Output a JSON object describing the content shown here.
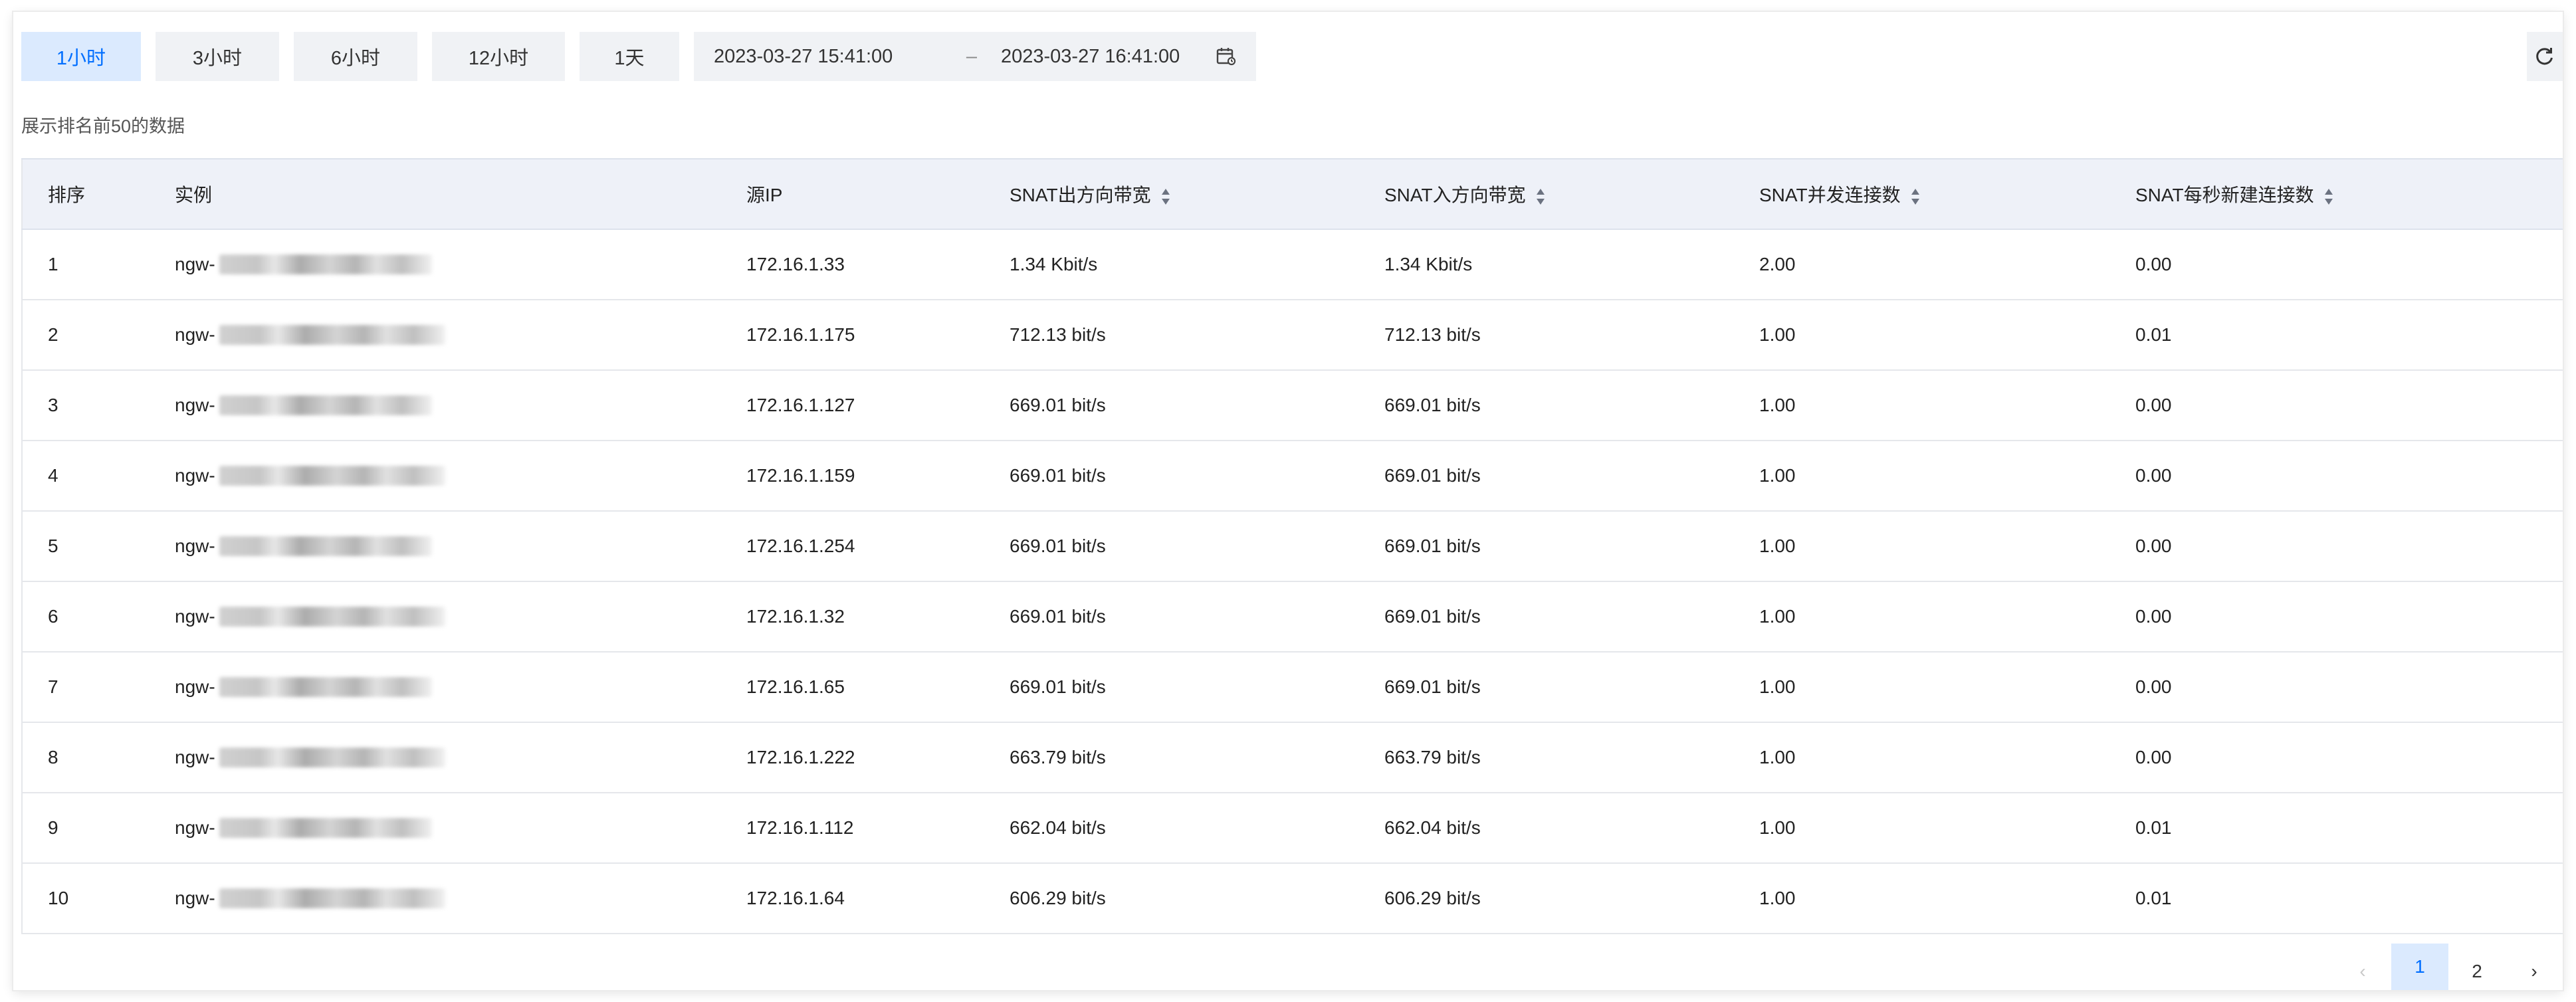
{
  "time_ranges": {
    "r1h": "1小时",
    "r3h": "3小时",
    "r6h": "6小时",
    "r12h": "12小时",
    "r1d": "1天"
  },
  "date_range": {
    "start": "2023-03-27 15:41:00",
    "separator": "–",
    "end": "2023-03-27 16:41:00"
  },
  "note": "展示排名前50的数据",
  "table": {
    "headers": {
      "rank": "排序",
      "instance": "实例",
      "source_ip": "源IP",
      "snat_out": "SNAT出方向带宽",
      "snat_in": "SNAT入方向带宽",
      "snat_conn": "SNAT并发连接数",
      "snat_new": "SNAT每秒新建连接数"
    },
    "rows": [
      {
        "rank": "1",
        "instance": "ngw-",
        "ip": "172.16.1.33",
        "out": "1.34 Kbit/s",
        "in": "1.34 Kbit/s",
        "conn": "2.00",
        "new": "0.00"
      },
      {
        "rank": "2",
        "instance": "ngw-",
        "ip": "172.16.1.175",
        "out": "712.13 bit/s",
        "in": "712.13 bit/s",
        "conn": "1.00",
        "new": "0.01"
      },
      {
        "rank": "3",
        "instance": "ngw-",
        "ip": "172.16.1.127",
        "out": "669.01 bit/s",
        "in": "669.01 bit/s",
        "conn": "1.00",
        "new": "0.00"
      },
      {
        "rank": "4",
        "instance": "ngw-",
        "ip": "172.16.1.159",
        "out": "669.01 bit/s",
        "in": "669.01 bit/s",
        "conn": "1.00",
        "new": "0.00"
      },
      {
        "rank": "5",
        "instance": "ngw-",
        "ip": "172.16.1.254",
        "out": "669.01 bit/s",
        "in": "669.01 bit/s",
        "conn": "1.00",
        "new": "0.00"
      },
      {
        "rank": "6",
        "instance": "ngw-",
        "ip": "172.16.1.32",
        "out": "669.01 bit/s",
        "in": "669.01 bit/s",
        "conn": "1.00",
        "new": "0.00"
      },
      {
        "rank": "7",
        "instance": "ngw-",
        "ip": "172.16.1.65",
        "out": "669.01 bit/s",
        "in": "669.01 bit/s",
        "conn": "1.00",
        "new": "0.00"
      },
      {
        "rank": "8",
        "instance": "ngw-",
        "ip": "172.16.1.222",
        "out": "663.79 bit/s",
        "in": "663.79 bit/s",
        "conn": "1.00",
        "new": "0.00"
      },
      {
        "rank": "9",
        "instance": "ngw-",
        "ip": "172.16.1.112",
        "out": "662.04 bit/s",
        "in": "662.04 bit/s",
        "conn": "1.00",
        "new": "0.01"
      },
      {
        "rank": "10",
        "instance": "ngw-",
        "ip": "172.16.1.64",
        "out": "606.29 bit/s",
        "in": "606.29 bit/s",
        "conn": "1.00",
        "new": "0.01"
      }
    ]
  },
  "pagination": {
    "prev": "‹",
    "page1": "1",
    "page2": "2",
    "next": "›"
  },
  "colors": {
    "accent": "#006eff",
    "active_bg": "#dbeafe",
    "button_bg": "#f0f2f5",
    "header_bg": "#eef1f8"
  },
  "icons": {
    "calendar": "calendar-icon",
    "refresh": "refresh-icon",
    "sort": "sort-icon"
  }
}
